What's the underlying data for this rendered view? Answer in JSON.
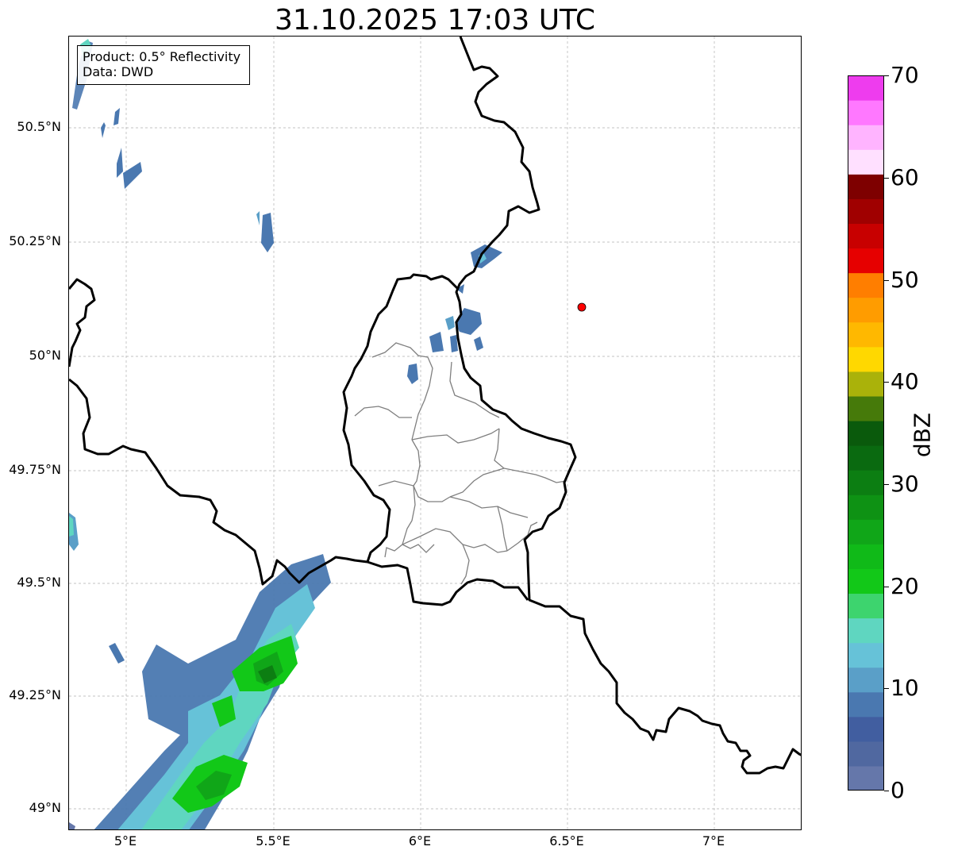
{
  "title": "31.10.2025 17:03 UTC",
  "info_box": {
    "product": "Product: 0.5° Reflectivity",
    "data_source": "Data: DWD"
  },
  "lat_labels": [
    "50.5°N",
    "50.25°N",
    "50°N",
    "49.75°N",
    "49.5°N",
    "49.25°N",
    "49°N"
  ],
  "lon_labels": [
    "5°E",
    "5.5°E",
    "6°E",
    "6.5°E",
    "7°E"
  ],
  "colorbar": {
    "label": "dBZ",
    "ticks": [
      "0",
      "10",
      "20",
      "30",
      "40",
      "50",
      "60",
      "70"
    ],
    "colors": [
      "#6577aa",
      "#5068a0",
      "#415ea0",
      "#4a78b0",
      "#5a9fc8",
      "#66c2d8",
      "#5fd6c0",
      "#3dd46e",
      "#12c818",
      "#10ba18",
      "#10a618",
      "#0e9214",
      "#0c7e12",
      "#0a6a10",
      "#0a5a0c",
      "#467a0a",
      "#aab20a",
      "#ffd800",
      "#ffb800",
      "#ff9c00",
      "#ff7e00",
      "#e60000",
      "#c80000",
      "#a00000",
      "#7e0000",
      "#ffe0ff",
      "#ffb4ff",
      "#ff78ff",
      "#ee3cee"
    ]
  },
  "colors": {
    "border": "#000000",
    "district_lines": "#7f7f7f",
    "grid": "#b0b0b0",
    "radar_marker": "#ff0000"
  },
  "map": {
    "lat_range": [
      48.95,
      50.7
    ],
    "lon_range": [
      4.8,
      7.3
    ],
    "radar_site": {
      "lat": 50.11,
      "lon": 6.55
    }
  }
}
